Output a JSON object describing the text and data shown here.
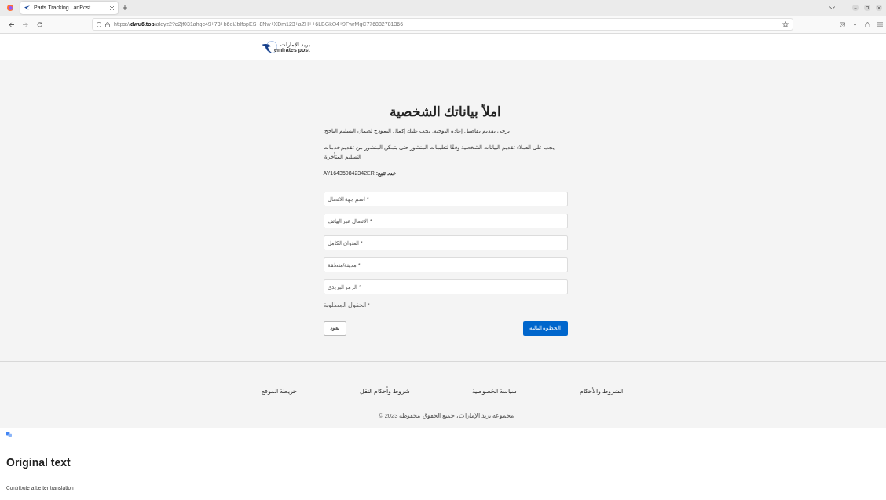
{
  "browser": {
    "tab": {
      "title": "Parts Tracking | anPost",
      "selected": true
    },
    "url": "https://**dwu6.top**/alqyz2?e2jf031ahgc49+78+b6diJbIfopES+8Nw+XDm123+aZH++6LBGkO4+9FwrMgC776882781366"
  },
  "logo": {
    "text_ar": "بريد الإمارات",
    "text_en": "emirates post"
  },
  "form": {
    "title": "املأ بياناتك الشخصية",
    "paragraphs": [
      "يرجى تقديم تفاصيل إعادة التوجيه. يجب عليك إكمال النموذج لضمان التسليم الناجح.",
      "يجب على العملاء تقديم البيانات الشخصية وفقًا لتعليمات المنشور حتى يتمكن المنشور من تقديم خدمات التسليم المتأخرة."
    ],
    "tracking": "**عدد تتبع:** AY164350842342ER",
    "fields": [
      {
        "placeholder": "اسم جهة الاتصال *"
      },
      {
        "placeholder": "الاتصال عبر الهاتف *"
      },
      {
        "placeholder": "العنوان الكامل *"
      },
      {
        "placeholder": "مدينة/منطقة *"
      },
      {
        "placeholder": "الرمز البريدي *"
      }
    ],
    "required_note": "الحقول المطلوبة *",
    "back_button": "يعود",
    "next_button": "الخطوة التالية"
  },
  "footer": {
    "links": [
      "الشروط والأحكام",
      "سياسة الخصوصية",
      "شروط وأحكام النقل",
      "خريطة الموقع"
    ],
    "copyright": "مجموعة بريد الإمارات، جميع الحقوق محفوظة 2023 ©"
  },
  "translation": {
    "heading": "Original text",
    "link": "Contribute a better translation"
  }
}
